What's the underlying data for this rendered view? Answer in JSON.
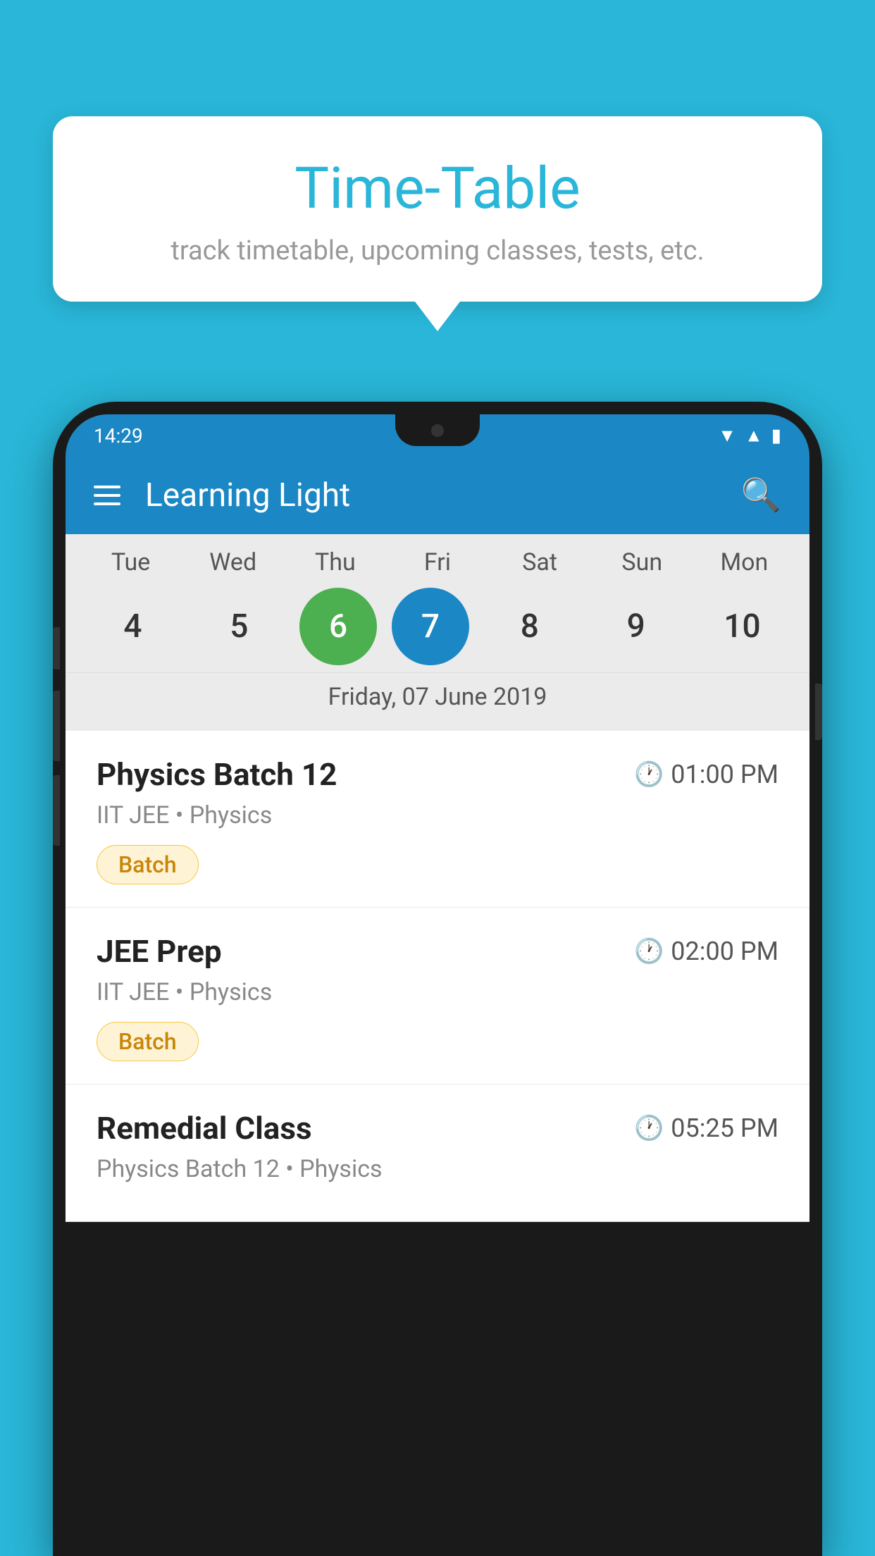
{
  "background": {
    "color": "#29B6D8"
  },
  "tooltip": {
    "title": "Time-Table",
    "subtitle": "track timetable, upcoming classes, tests, etc."
  },
  "appbar": {
    "title": "Learning Light",
    "menu_icon": "hamburger-icon",
    "search_icon": "search-icon"
  },
  "status_bar": {
    "time": "14:29"
  },
  "calendar": {
    "days": [
      {
        "label": "Tue",
        "number": "4"
      },
      {
        "label": "Wed",
        "number": "5"
      },
      {
        "label": "Thu",
        "number": "6",
        "state": "today"
      },
      {
        "label": "Fri",
        "number": "7",
        "state": "selected"
      },
      {
        "label": "Sat",
        "number": "8"
      },
      {
        "label": "Sun",
        "number": "9"
      },
      {
        "label": "Mon",
        "number": "10"
      }
    ],
    "selected_date_label": "Friday, 07 June 2019"
  },
  "classes": [
    {
      "name": "Physics Batch 12",
      "time": "01:00 PM",
      "meta": "IIT JEE • Physics",
      "badge": "Batch"
    },
    {
      "name": "JEE Prep",
      "time": "02:00 PM",
      "meta": "IIT JEE • Physics",
      "badge": "Batch"
    },
    {
      "name": "Remedial Class",
      "time": "05:25 PM",
      "meta": "Physics Batch 12 • Physics",
      "badge": null
    }
  ]
}
